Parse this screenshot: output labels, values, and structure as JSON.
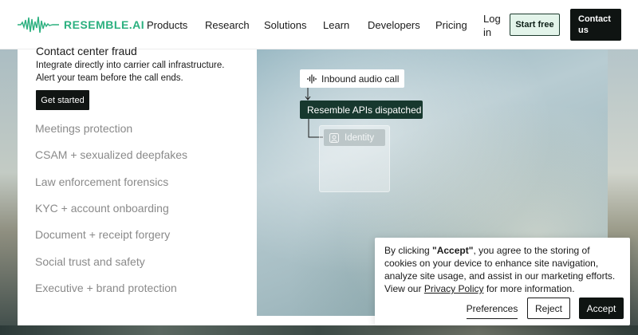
{
  "header": {
    "logo_text": "RESEMBLE.AI",
    "nav": [
      "Products",
      "Research",
      "Solutions",
      "Learn",
      "Developers",
      "Pricing"
    ],
    "login": "Log in",
    "start_free": "Start free",
    "contact_us": "Contact us"
  },
  "hero": {
    "title": "Contact center fraud",
    "desc_line1": "Integrate directly into carrier call infrastructure.",
    "desc_line2": "Alert your team before the call ends.",
    "cta": "Get started"
  },
  "use_cases": [
    "Meetings protection",
    "CSAM + sexualized deepfakes",
    "Law enforcement forensics",
    "KYC + account onboarding",
    "Document + receipt forgery",
    "Social trust and safety",
    "Executive + brand protection"
  ],
  "flow": {
    "step1": "Inbound audio call",
    "step2": "Resemble APIs dispatched",
    "step3": "Identity",
    "step1_icon": "audio-wave-icon",
    "step3_icon": "identity-icon"
  },
  "cookie": {
    "text_before": "By clicking ",
    "accept_quoted": "\"Accept\"",
    "text_after": ", you agree to the storing of cookies on your device to enhance site navigation, analyze site usage, and assist in our marketing efforts. View our ",
    "privacy_link": "Privacy Policy",
    "text_end": " for more information.",
    "preferences": "Preferences",
    "reject": "Reject",
    "accept": "Accept"
  },
  "colors": {
    "brand": "#2bb07f",
    "dark": "#0f1412",
    "dispatched_bg": "#17382e",
    "muted_text": "#8a8a8a"
  }
}
